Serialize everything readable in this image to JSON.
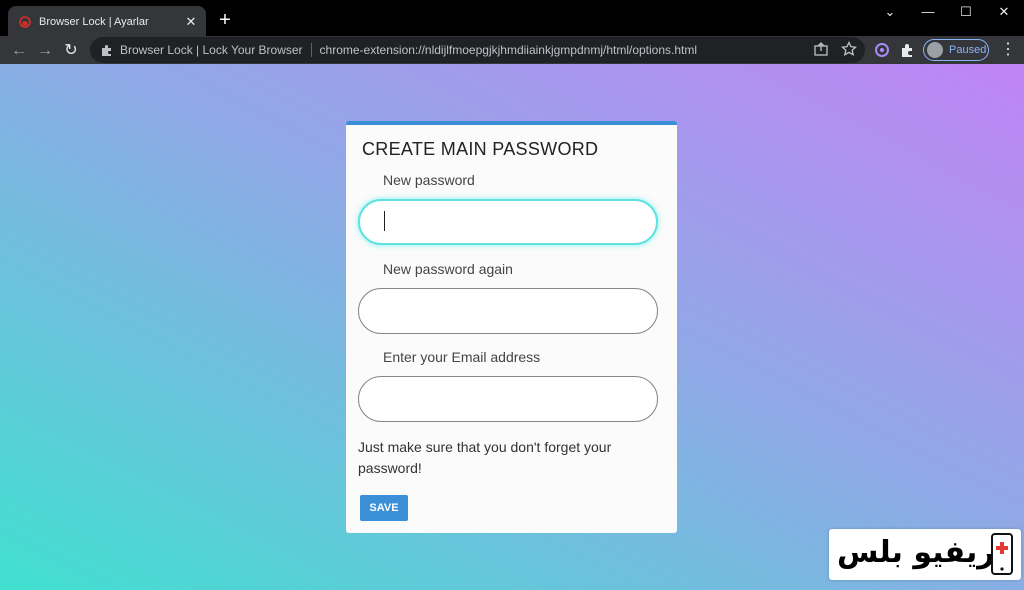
{
  "tab": {
    "title": "Browser Lock | Ayarlar",
    "close": "✕",
    "icon": "browser-lock-favicon"
  },
  "new_tab": "+",
  "window_controls": {
    "tab_search": "⌄",
    "minimize": "—",
    "maximize": "☐",
    "close": "✕"
  },
  "toolbar": {
    "back": "←",
    "forward": "→",
    "reload": "↻",
    "site_chip": "Browser Lock | Lock Your Browser",
    "url": "chrome-extension://nldijlfmoepgjkjhmdiiainkjgmpdnmj/html/options.html",
    "profile_label": "Paused",
    "menu": "⋮"
  },
  "card": {
    "title": "CREATE MAIN PASSWORD",
    "new_password_label": "New password",
    "new_password_value": "",
    "new_password_again_label": "New password again",
    "new_password_again_value": "",
    "email_label": "Enter your Email address",
    "email_value": "",
    "note": "Just make sure that you don't forget your password!",
    "save_label": "SAVE"
  },
  "watermark": {
    "text": "ريفيو بلس"
  },
  "colors": {
    "accent": "#3a8fd6",
    "focus": "#5ee1e0",
    "gradient_start": "#40e0d0",
    "gradient_end": "#c084f5"
  }
}
